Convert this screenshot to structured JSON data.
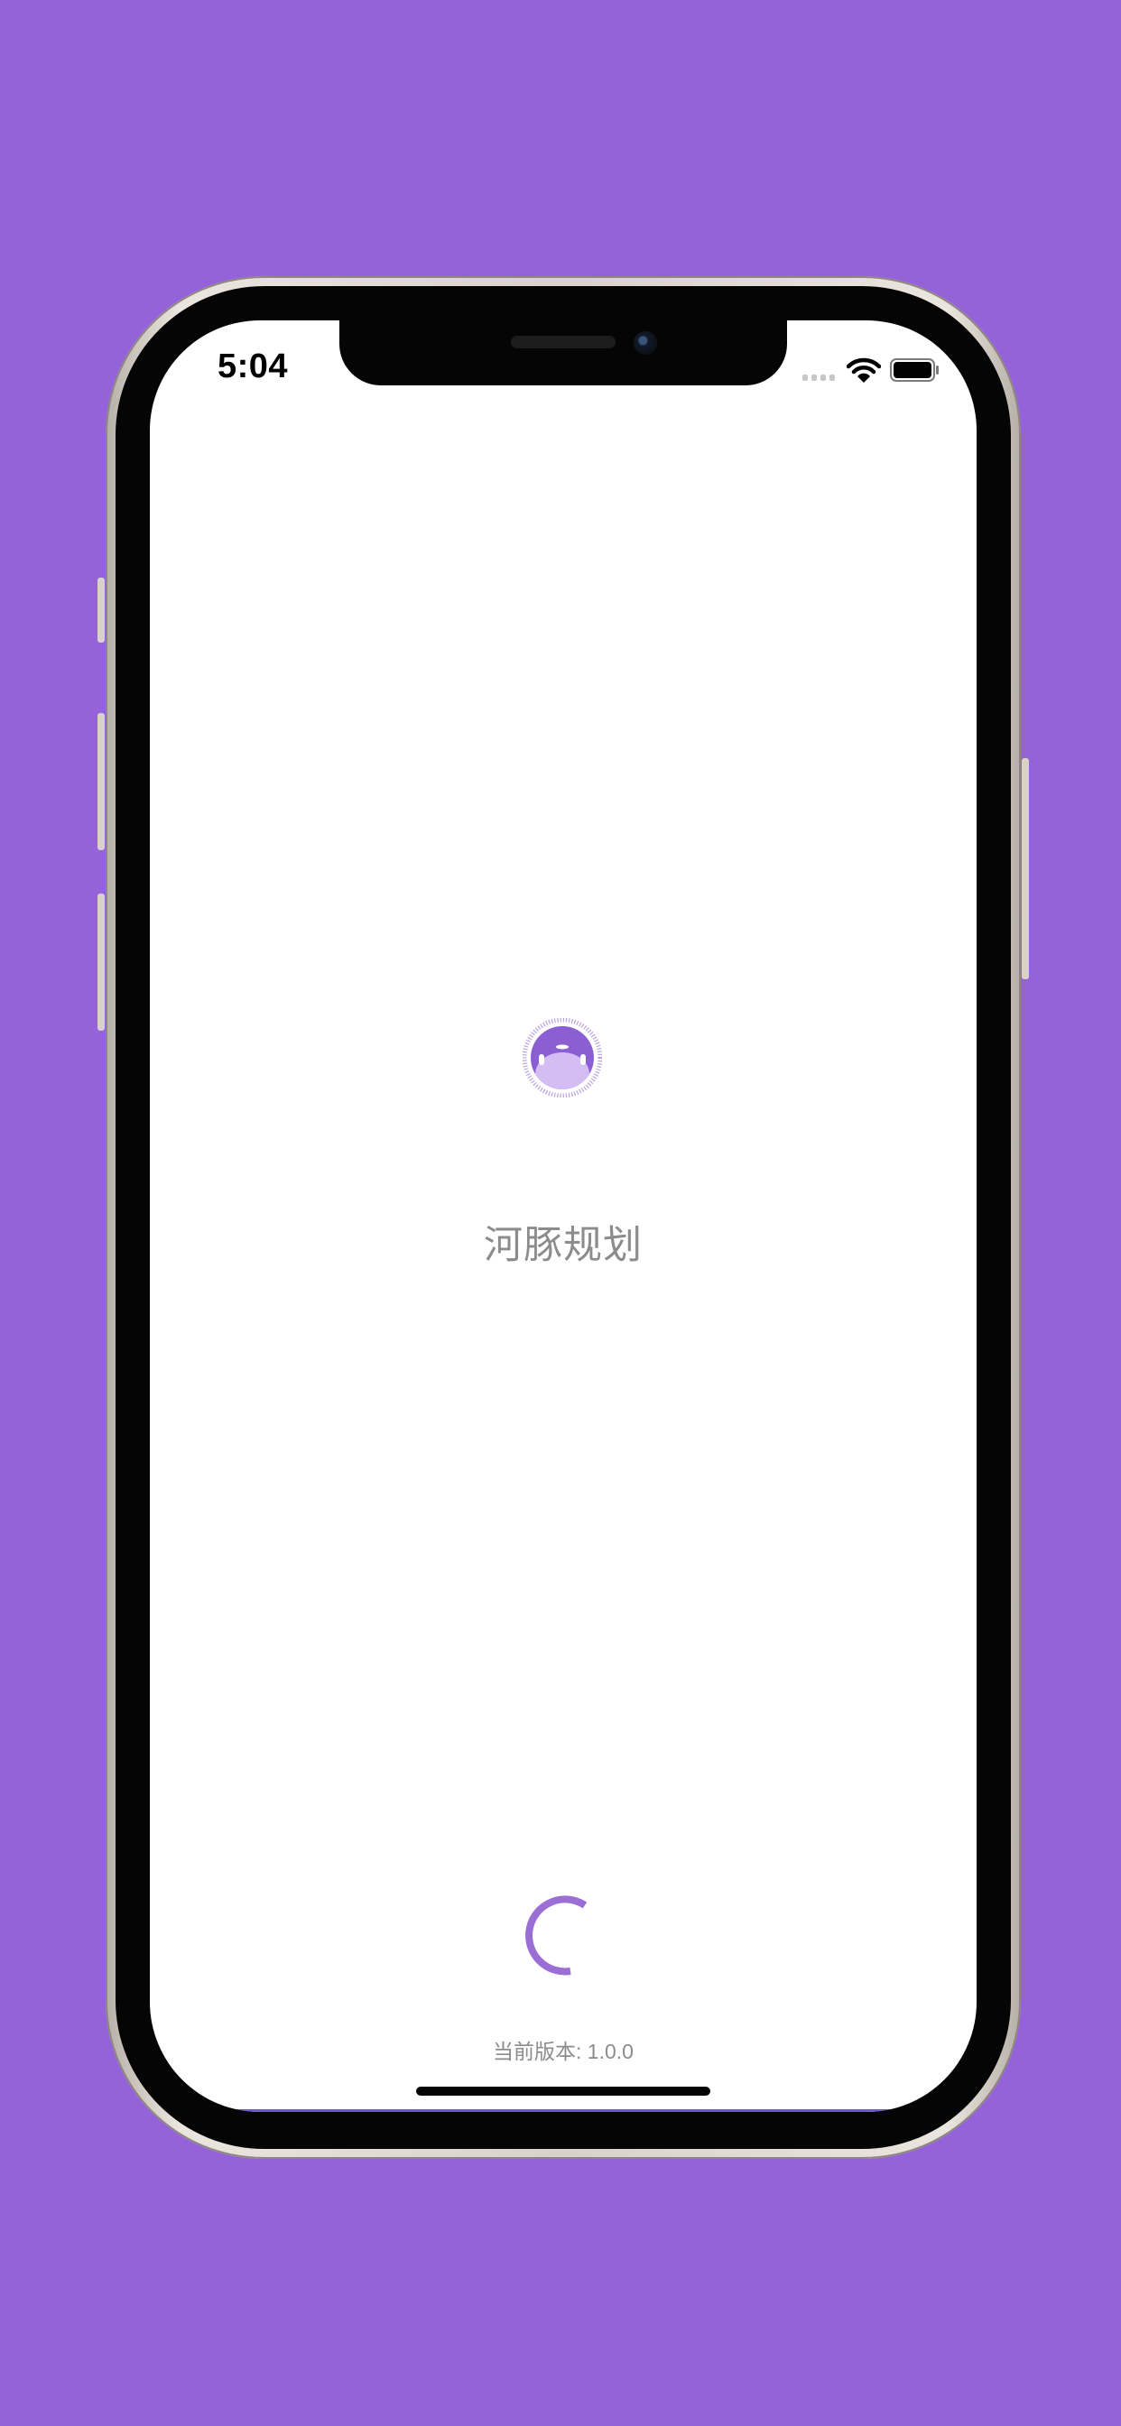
{
  "status_bar": {
    "time": "5:04",
    "icons": [
      "signal-icon",
      "wifi-icon",
      "battery-icon"
    ],
    "battery_level": 1.0
  },
  "splash": {
    "logo_icon": "pufferfish-logo-icon",
    "app_name": "河豚规划",
    "loading_icon": "loading-spinner-icon",
    "version_text": "当前版本: 1.0.0"
  },
  "colors": {
    "background": "#9563d9",
    "accent": "#9b6ed6",
    "text_muted": "#8c8c8c"
  }
}
